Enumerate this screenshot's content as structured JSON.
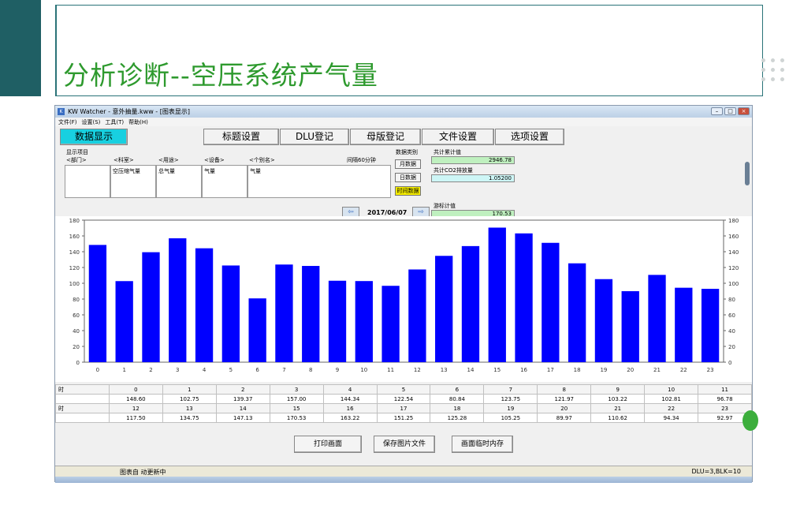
{
  "slide": {
    "title": "分析诊断--空压系统产气量"
  },
  "window": {
    "title": "KW Watcher - 意外抽量.kww - [图表显示]",
    "menu": [
      "文件(F)",
      "设置(S)",
      "工具(T)",
      "帮助(H)"
    ]
  },
  "toolbar": {
    "tabs": [
      "数据显示",
      "标题设置",
      "DLU登记",
      "母版登记",
      "文件设置",
      "选项设置"
    ],
    "active": "数据显示"
  },
  "selection": {
    "display_label": "显示项目",
    "columns": [
      {
        "header": "<部门>",
        "value": ""
      },
      {
        "header": "<科室>",
        "value": "空压缩气量"
      },
      {
        "header": "<用途>",
        "value": "总气量"
      },
      {
        "header": "<设备>",
        "value": "气量"
      },
      {
        "header": "<个别名>",
        "value": "气量"
      }
    ],
    "interval_label": "间隔60分钟",
    "category_label": "数据类别",
    "categories": [
      "月数据",
      "日数据",
      "时间数据"
    ],
    "active_category": "时间数据",
    "total_label": "共计累计值",
    "total_value": "2946.78",
    "co2_label": "共计CO2排放量",
    "co2_value": "1.05200",
    "cursor_label": "游标计值",
    "cursor_value": "170.53",
    "date": "2017/06/07"
  },
  "chart_data": {
    "type": "bar",
    "categories": [
      "0",
      "1",
      "2",
      "3",
      "4",
      "5",
      "6",
      "7",
      "8",
      "9",
      "10",
      "11",
      "12",
      "13",
      "14",
      "15",
      "16",
      "17",
      "18",
      "19",
      "20",
      "21",
      "22",
      "23"
    ],
    "values": [
      148.6,
      102.75,
      139.37,
      157.0,
      144.34,
      122.54,
      80.84,
      123.75,
      121.97,
      103.22,
      102.81,
      96.78,
      117.5,
      134.75,
      147.13,
      170.53,
      163.22,
      151.25,
      125.28,
      105.25,
      89.97,
      110.62,
      94.34,
      92.97
    ],
    "ylim": [
      0,
      180
    ],
    "yticks": [
      "0",
      "20",
      "40",
      "60",
      "80",
      "100",
      "120",
      "140",
      "160",
      "180"
    ],
    "bar_color": "#0000ff"
  },
  "table": {
    "row_label": "时",
    "first_hours": [
      "0",
      "1",
      "2",
      "3",
      "4",
      "5",
      "6",
      "7",
      "8",
      "9",
      "10",
      "11"
    ],
    "first_values": [
      "148.60",
      "102.75",
      "139.37",
      "157.00",
      "144.34",
      "122.54",
      "80.84",
      "123.75",
      "121.97",
      "103.22",
      "102.81",
      "96.78"
    ],
    "second_hours": [
      "12",
      "13",
      "14",
      "15",
      "16",
      "17",
      "18",
      "19",
      "20",
      "21",
      "22",
      "23"
    ],
    "second_values": [
      "117.50",
      "134.75",
      "147.13",
      "170.53",
      "163.22",
      "151.25",
      "125.28",
      "105.25",
      "89.97",
      "110.62",
      "94.34",
      "92.97"
    ]
  },
  "buttons": {
    "print": "打印画面",
    "save_image": "保存图片文件",
    "temp_memory": "画面临时内存"
  },
  "status": {
    "left": "图表自 动更新中",
    "right": "DLU=3,BLK=10"
  }
}
